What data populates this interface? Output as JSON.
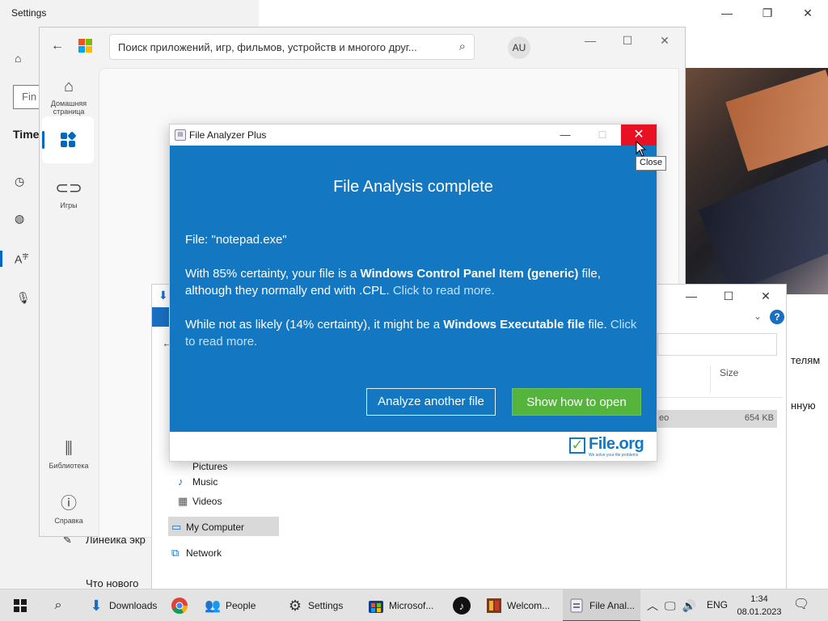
{
  "settings": {
    "title": "Settings",
    "find_placeholder": "Fin",
    "time_heading": "Time",
    "text_right_1": "телям",
    "text_right_2": "нную",
    "line_1": "Линейка экр",
    "line_2": "Что нового"
  },
  "store": {
    "search_text": "Поиск приложений, игр, фильмов, устройств и многого друг...",
    "avatar": "AU",
    "nav": {
      "home": "Домашняя страница",
      "games": "Игры",
      "library": "Библиотека",
      "help": "Справка"
    }
  },
  "explorer": {
    "size_header": "Size",
    "row_name": "eo",
    "row_size": "654 KB",
    "nav_items": [
      "Pictures",
      "Music",
      "Videos",
      "My Computer",
      "Network"
    ]
  },
  "dialog": {
    "title": "File Analyzer Plus",
    "heading": "File Analysis complete",
    "file_line": "File: \"notepad.exe\"",
    "p1_pre": "With 85% certainty, your file is a ",
    "p1_bold": "Windows Control Panel Item (generic)",
    "p1_post": " file, although they normally end with .CPL. ",
    "p1_link": "Click to read more.",
    "p2_pre": "While not as likely (14% certainty), it might be a ",
    "p2_bold": "Windows Executable file",
    "p2_post": " file. ",
    "p2_link": "Click to read more.",
    "btn_analyze": "Analyze another file",
    "btn_show": "Show how to open",
    "logo_text": "File.org",
    "logo_tagline": "We solve your file problems",
    "close_tooltip": "Close",
    "colors": {
      "panel": "#1477c2",
      "close": "#e81123",
      "show_btn": "#55b43b"
    }
  },
  "taskbar": {
    "items": [
      {
        "label": "Downloads"
      },
      {
        "label": "People"
      },
      {
        "label": "Settings"
      },
      {
        "label": "Microsof..."
      },
      {
        "label": "Welcom..."
      },
      {
        "label": "File Anal..."
      }
    ],
    "lang": "ENG",
    "time": "1:34",
    "date": "08.01.2023"
  }
}
